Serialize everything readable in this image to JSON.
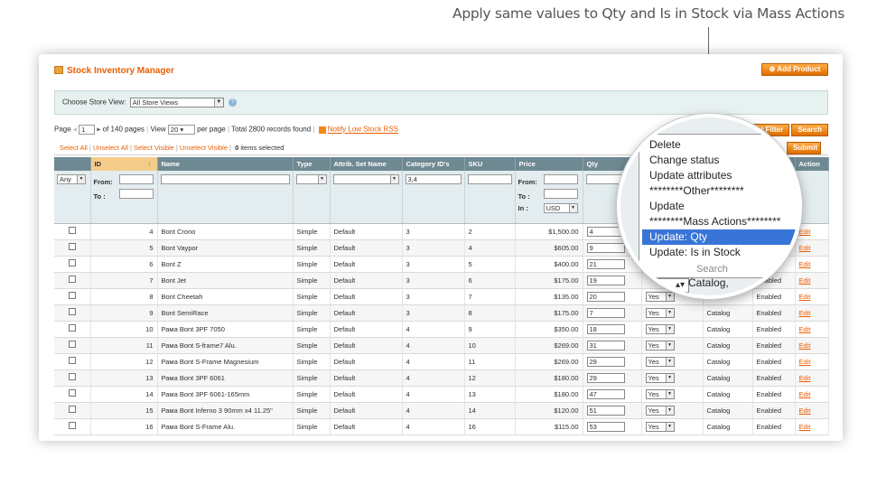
{
  "annotation": "Apply same values to Qty and Is in Stock via Mass Actions",
  "header": {
    "title": "Stock Inventory Manager",
    "add_label": "Add Product"
  },
  "store": {
    "label": "Choose Store View:",
    "value": "All Store Views"
  },
  "pager": {
    "page_label": "Page",
    "page_value": "1",
    "of_pages": "of 140 pages",
    "view_label": "View",
    "view_value": "20",
    "per_page": "per page",
    "total": "Total 2800 records found",
    "rss_label": "Notify Low Stock RSS",
    "reset_label": "Reset Filter",
    "search_label": "Search"
  },
  "mass": {
    "select_all": "Select All",
    "unselect_all": "Unselect All",
    "select_visible": "Select Visible",
    "unselect_visible": "Unselect Visible",
    "items_selected_count": "0",
    "items_selected_text": "items selected",
    "submit_label": "Submit"
  },
  "columns": [
    "",
    "ID",
    "Name",
    "Type",
    "Attrib. Set Name",
    "Category ID's",
    "SKU",
    "Price",
    "Qty",
    "",
    "",
    "",
    "Action"
  ],
  "filters": {
    "any": "Any",
    "from": "From:",
    "to": "To :",
    "in": "In :",
    "currency": "USD",
    "category": "3,4"
  },
  "rows": [
    {
      "id": "4",
      "name": "Bont Crono",
      "type": "Simple",
      "set": "Default",
      "cat": "3",
      "sku": "2",
      "price": "$1,500.00",
      "qty": "4",
      "stock": "",
      "vis": "",
      "status": "",
      "action": "Edit"
    },
    {
      "id": "5",
      "name": "Bont Vaypor",
      "type": "Simple",
      "set": "Default",
      "cat": "3",
      "sku": "4",
      "price": "$605.00",
      "qty": "9",
      "stock": "",
      "vis": "",
      "status": "",
      "action": "Edit"
    },
    {
      "id": "6",
      "name": "Bont Z",
      "type": "Simple",
      "set": "Default",
      "cat": "3",
      "sku": "5",
      "price": "$400.00",
      "qty": "21",
      "stock": "",
      "vis": "",
      "status": "",
      "action": "Edit"
    },
    {
      "id": "7",
      "name": "Bont Jet",
      "type": "Simple",
      "set": "Default",
      "cat": "3",
      "sku": "6",
      "price": "$175.00",
      "qty": "19",
      "stock": "",
      "vis": "",
      "status": "Enabled",
      "action": "Edit"
    },
    {
      "id": "8",
      "name": "Bont Cheetah",
      "type": "Simple",
      "set": "Default",
      "cat": "3",
      "sku": "7",
      "price": "$135.00",
      "qty": "20",
      "stock": "Yes",
      "vis": "",
      "status": "Enabled",
      "action": "Edit"
    },
    {
      "id": "9",
      "name": "Bont SemiRace",
      "type": "Simple",
      "set": "Default",
      "cat": "3",
      "sku": "8",
      "price": "$175.00",
      "qty": "7",
      "stock": "Yes",
      "vis": "Catalog",
      "status": "Enabled",
      "action": "Edit"
    },
    {
      "id": "10",
      "name": "Рама Bont 3PF 7050",
      "type": "Simple",
      "set": "Default",
      "cat": "4",
      "sku": "9",
      "price": "$350.00",
      "qty": "18",
      "stock": "Yes",
      "vis": "Catalog",
      "status": "Enabled",
      "action": "Edit"
    },
    {
      "id": "11",
      "name": "Рама Bont S-frame7 Alu.",
      "type": "Simple",
      "set": "Default",
      "cat": "4",
      "sku": "10",
      "price": "$269.00",
      "qty": "31",
      "stock": "Yes",
      "vis": "Catalog",
      "status": "Enabled",
      "action": "Edit"
    },
    {
      "id": "12",
      "name": "Рама Bont S-Frame Magnesium",
      "type": "Simple",
      "set": "Default",
      "cat": "4",
      "sku": "11",
      "price": "$269.00",
      "qty": "29",
      "stock": "Yes",
      "vis": "Catalog",
      "status": "Enabled",
      "action": "Edit"
    },
    {
      "id": "13",
      "name": "Рама Bont 3PF 6061",
      "type": "Simple",
      "set": "Default",
      "cat": "4",
      "sku": "12",
      "price": "$180.00",
      "qty": "29",
      "stock": "Yes",
      "vis": "Catalog",
      "status": "Enabled",
      "action": "Edit"
    },
    {
      "id": "14",
      "name": "Рама Bont 3PF 6061-165mm",
      "type": "Simple",
      "set": "Default",
      "cat": "4",
      "sku": "13",
      "price": "$180.00",
      "qty": "47",
      "stock": "Yes",
      "vis": "Catalog",
      "status": "Enabled",
      "action": "Edit"
    },
    {
      "id": "15",
      "name": "Рама Bont Inferno 3 90mm x4 11.25\"",
      "type": "Simple",
      "set": "Default",
      "cat": "4",
      "sku": "14",
      "price": "$120.00",
      "qty": "51",
      "stock": "Yes",
      "vis": "Catalog",
      "status": "Enabled",
      "action": "Edit"
    },
    {
      "id": "16",
      "name": "Рама Bont S-Frame Alu.",
      "type": "Simple",
      "set": "Default",
      "cat": "4",
      "sku": "16",
      "price": "$115.00",
      "qty": "53",
      "stock": "Yes",
      "vis": "Catalog",
      "status": "Enabled",
      "action": "Edit"
    }
  ],
  "mass_menu": [
    "Delete",
    "Change status",
    "Update attributes",
    "********Other********",
    "Update",
    "********Mass Actions********",
    "Update: Qty",
    "Update: Is in Stock"
  ],
  "mass_menu_selected": "Update: Qty",
  "magnifier": {
    "peek_search": "Search",
    "peek_catalog": "Catalog,",
    "peek_yes": "Yes"
  },
  "colors": {
    "accent": "#eb5e00",
    "header_bg": "#6f8992",
    "highlight": "#3875d7"
  }
}
